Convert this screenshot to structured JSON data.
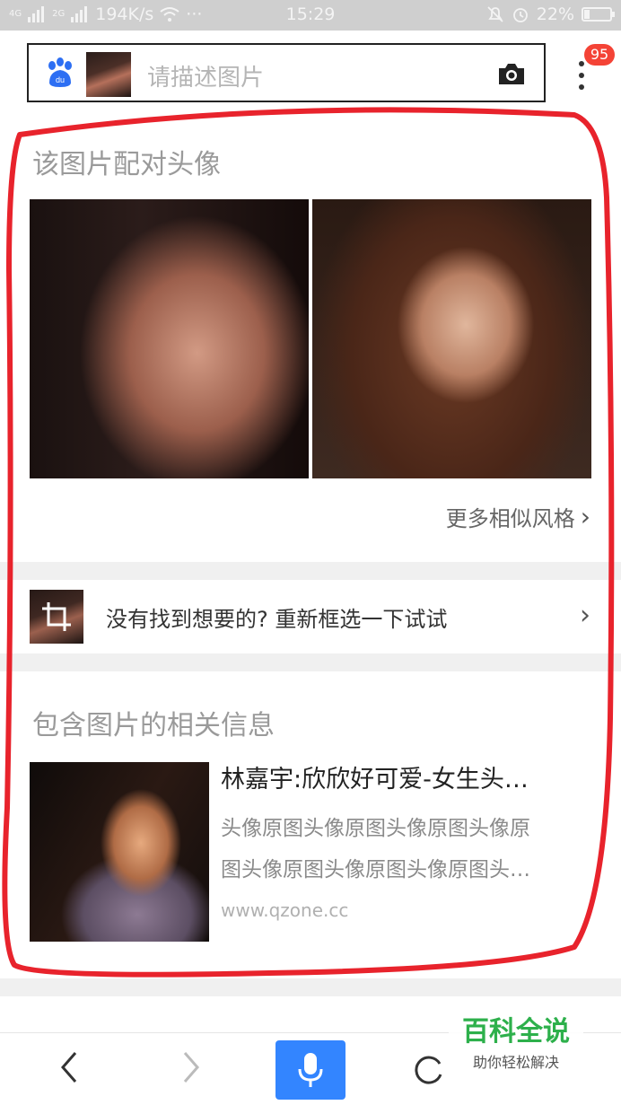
{
  "status_bar": {
    "signal1": "4G",
    "signal2": "2G",
    "speed": "194K/s",
    "dots": "···",
    "time": "15:29",
    "battery": "22%"
  },
  "search": {
    "placeholder": "请描述图片",
    "badge_count": "95"
  },
  "section_pair": {
    "title": "该图片配对头像",
    "more_link": "更多相似风格"
  },
  "crop_prompt": {
    "text": "没有找到想要的? 重新框选一下试试"
  },
  "related": {
    "title": "包含图片的相关信息",
    "item": {
      "headline": "林嘉宇:欣欣好可爱-女生头…",
      "description_line1": "头像原图头像原图头像原图头像原",
      "description_line2": "图头像原图头像原图头像原图头…",
      "source": "www.qzone.cc"
    }
  },
  "watermark": {
    "title": "百科全说",
    "subtitle": "助你轻松解决"
  },
  "colors": {
    "accent_blue": "#3385ff",
    "annotation_red": "#e8232c",
    "badge_red": "#f44336",
    "watermark_green": "#2db04b"
  },
  "icons": [
    "baidu-paw-icon",
    "camera-icon",
    "more-vertical-icon",
    "crop-icon",
    "chevron-right-icon",
    "back-icon",
    "forward-icon",
    "mic-icon",
    "refresh-icon"
  ]
}
